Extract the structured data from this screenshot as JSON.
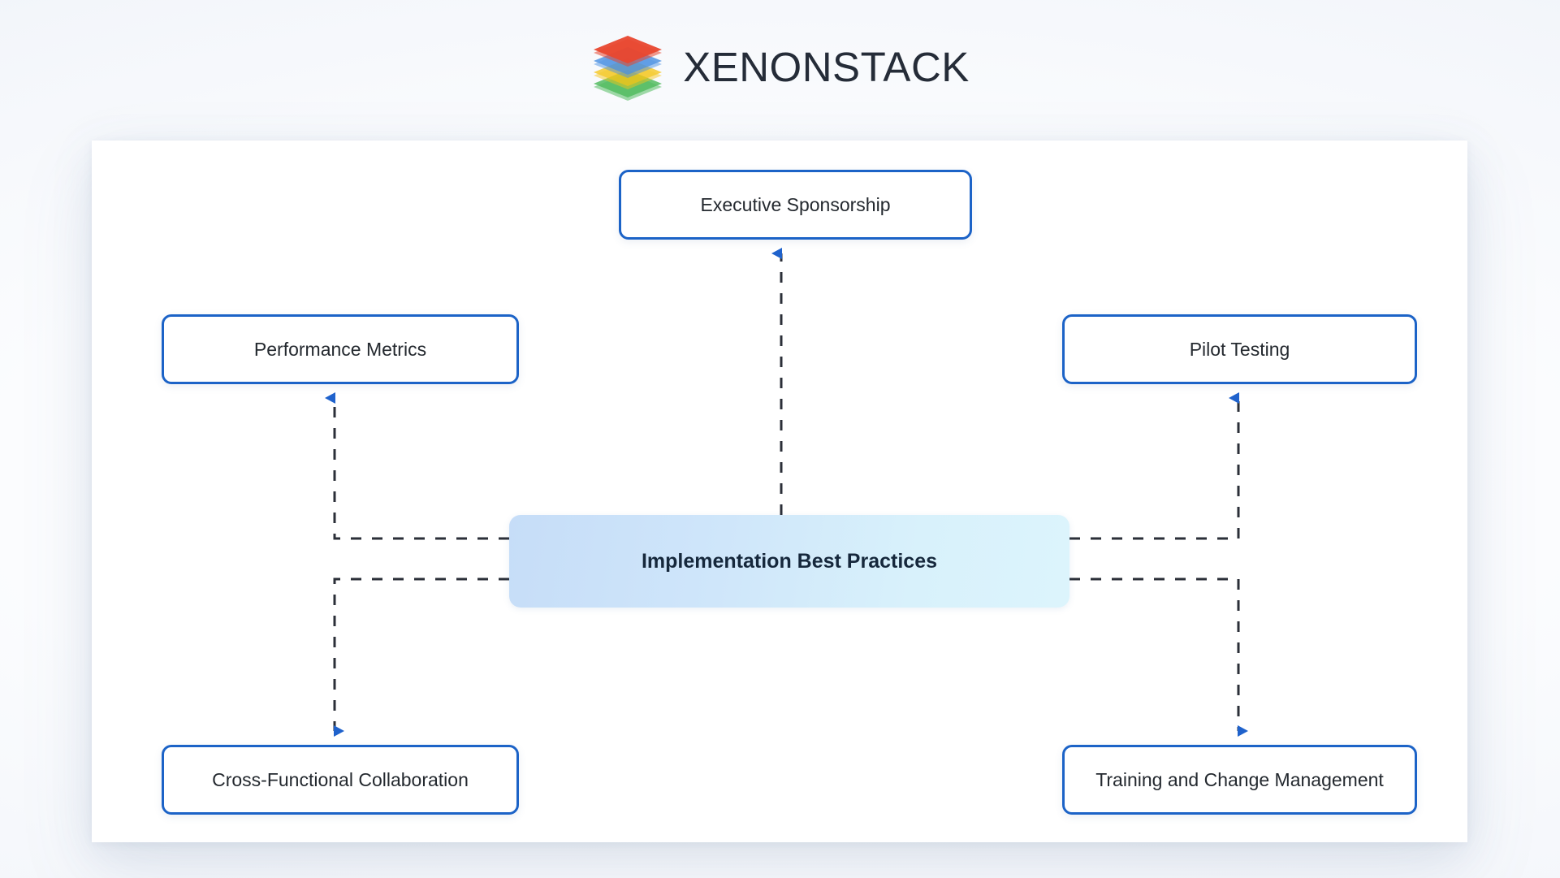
{
  "header": {
    "logo_icon": "xenonstack-stacked-layers-logo",
    "brand_name": "XENONSTACK",
    "logo_layer_colors": [
      "#e8472f",
      "#4a90e2",
      "#f5c518",
      "#3cb44b"
    ]
  },
  "diagram": {
    "type": "hub-and-spoke",
    "accent_color": "#1c63c7",
    "connector_color": "#2b2f38",
    "center": {
      "id": "implementation-best-practices",
      "label": "Implementation Best Practices",
      "fill_start": "#c6ddf8",
      "fill_end": "#dcf4fc",
      "text_color": "#16283c"
    },
    "nodes": [
      {
        "id": "executive-sponsorship",
        "label": "Executive Sponsorship",
        "position": "top-center",
        "arrow_direction": "up",
        "connector": "straight-vertical"
      },
      {
        "id": "performance-metrics",
        "label": "Performance Metrics",
        "position": "mid-left",
        "arrow_direction": "up",
        "connector": "elbow"
      },
      {
        "id": "pilot-testing",
        "label": "Pilot Testing",
        "position": "mid-right",
        "arrow_direction": "up",
        "connector": "elbow"
      },
      {
        "id": "cross-functional-collaboration",
        "label": "Cross-Functional Collaboration",
        "position": "bottom-left",
        "arrow_direction": "down",
        "connector": "elbow"
      },
      {
        "id": "training-and-change-management",
        "label": "Training and Change Management",
        "position": "bottom-right",
        "arrow_direction": "down",
        "connector": "elbow"
      }
    ]
  }
}
